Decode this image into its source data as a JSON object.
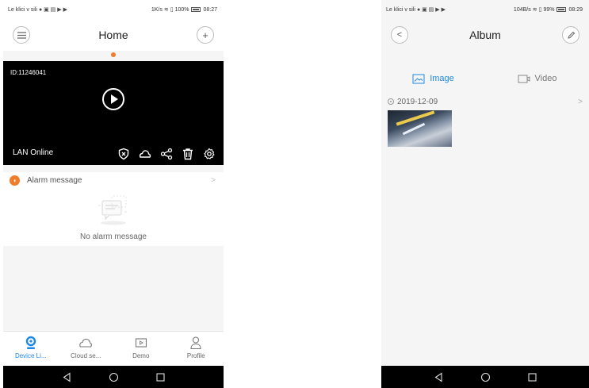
{
  "left": {
    "status": {
      "carrier": "Le klici v sili",
      "speed": "1K/s",
      "battery": "100%",
      "time": "08:27"
    },
    "title": "Home",
    "camera": {
      "id": "ID:11246041",
      "connection": "LAN Online"
    },
    "alarm": {
      "label": "Alarm message",
      "empty": "No alarm message"
    },
    "tabs": [
      {
        "label": "Device Li..."
      },
      {
        "label": "Cloud se..."
      },
      {
        "label": "Demo"
      },
      {
        "label": "Profile"
      }
    ]
  },
  "right": {
    "status": {
      "carrier": "Le klici v sili",
      "speed": "104B/s",
      "battery": "99%",
      "time": "08:29"
    },
    "title": "Album",
    "tabs": [
      {
        "label": "Image"
      },
      {
        "label": "Video"
      }
    ],
    "date": "2019-12-09"
  },
  "colors": {
    "accent": "#f07c2a",
    "active_blue": "#1e88e5"
  }
}
